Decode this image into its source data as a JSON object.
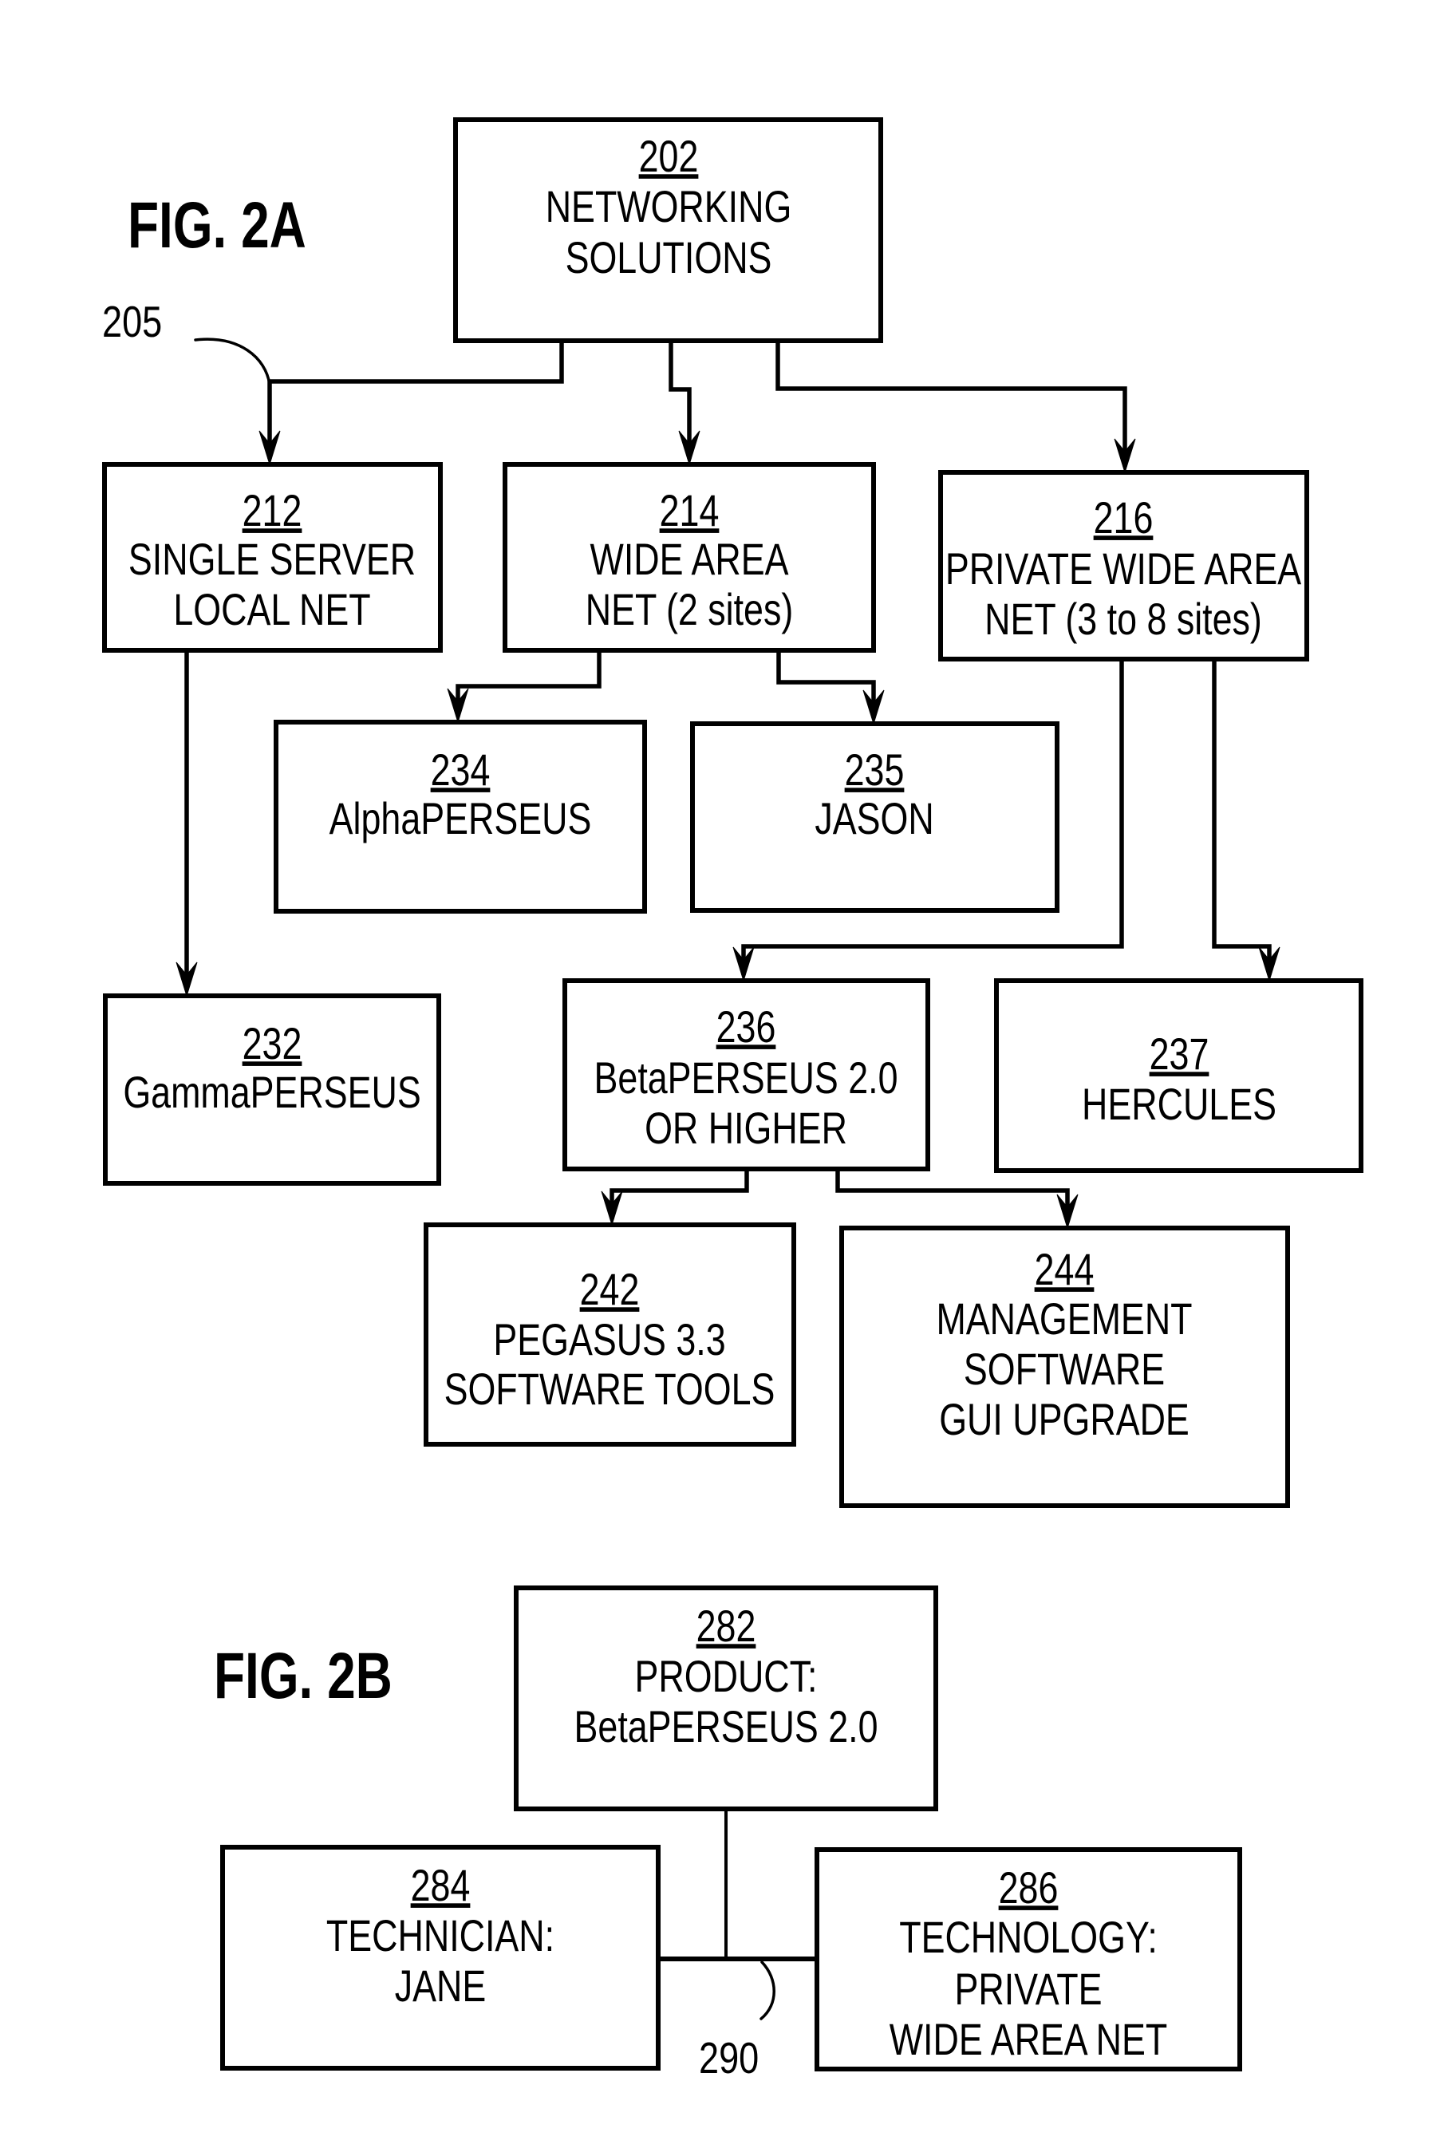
{
  "fig2a": {
    "title": "FIG. 2A",
    "callout": "205",
    "boxes": {
      "b202": {
        "ref": "202",
        "lines": [
          "NETWORKING",
          "SOLUTIONS"
        ]
      },
      "b212": {
        "ref": "212",
        "lines": [
          "SINGLE SERVER",
          "LOCAL NET"
        ]
      },
      "b214": {
        "ref": "214",
        "lines": [
          "WIDE AREA",
          "NET (2 sites)"
        ]
      },
      "b216": {
        "ref": "216",
        "lines": [
          "PRIVATE WIDE AREA",
          "NET (3 to 8 sites)"
        ]
      },
      "b234": {
        "ref": "234",
        "lines": [
          "AlphaPERSEUS"
        ]
      },
      "b235": {
        "ref": "235",
        "lines": [
          "JASON"
        ]
      },
      "b232": {
        "ref": "232",
        "lines": [
          "GammaPERSEUS"
        ]
      },
      "b236": {
        "ref": "236",
        "lines": [
          "BetaPERSEUS 2.0",
          "OR HIGHER"
        ]
      },
      "b237": {
        "ref": "237",
        "lines": [
          "HERCULES"
        ]
      },
      "b242": {
        "ref": "242",
        "lines": [
          "PEGASUS 3.3",
          "SOFTWARE TOOLS"
        ]
      },
      "b244": {
        "ref": "244",
        "lines": [
          "MANAGEMENT",
          "SOFTWARE",
          "GUI UPGRADE"
        ]
      }
    }
  },
  "fig2b": {
    "title": "FIG. 2B",
    "callout": "290",
    "boxes": {
      "b282": {
        "ref": "282",
        "lines": [
          "PRODUCT:",
          "BetaPERSEUS 2.0"
        ]
      },
      "b284": {
        "ref": "284",
        "lines": [
          "TECHNICIAN:",
          "JANE"
        ]
      },
      "b286": {
        "ref": "286",
        "lines": [
          "TECHNOLOGY:",
          "PRIVATE",
          "WIDE AREA NET"
        ]
      }
    }
  }
}
